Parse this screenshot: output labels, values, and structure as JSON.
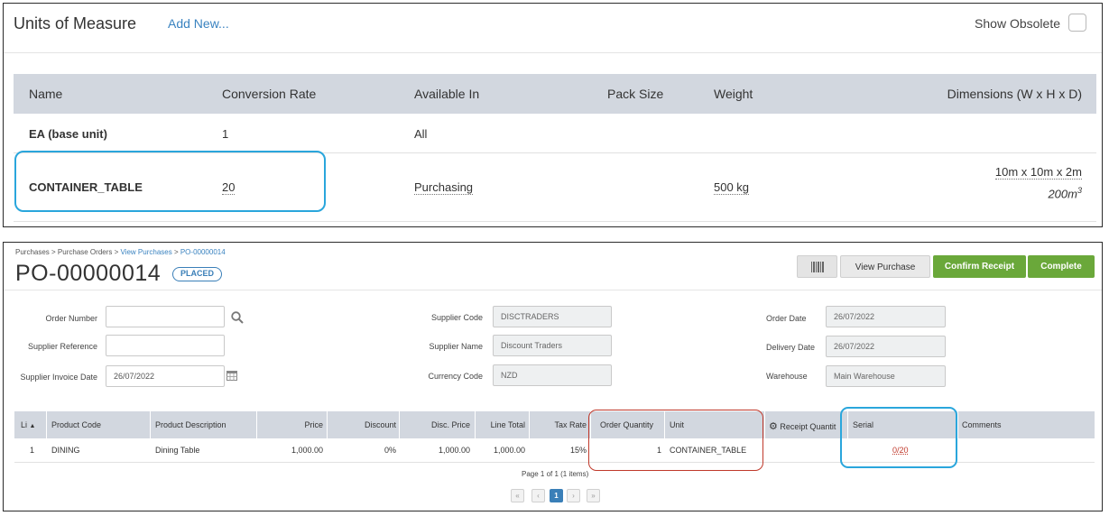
{
  "uom": {
    "title": "Units of Measure",
    "add_new": "Add New...",
    "show_obsolete": "Show Obsolete",
    "columns": [
      "Name",
      "Conversion Rate",
      "Available In",
      "Pack Size",
      "Weight",
      "Dimensions (W x H x D)"
    ],
    "rows": [
      {
        "name": "EA (base unit)",
        "conversion": "1",
        "available": "All",
        "pack": "",
        "weight": "",
        "dimensions": "",
        "volume": ""
      },
      {
        "name": "CONTAINER_TABLE",
        "conversion": "20",
        "available": "Purchasing",
        "pack": "",
        "weight": "500 kg",
        "dimensions": "10m x 10m x 2m",
        "volume": "200m",
        "volume_exp": "3"
      }
    ]
  },
  "po": {
    "breadcrumb": {
      "part1": "Purchases > Purchase Orders > ",
      "link1": "View Purchases",
      "sep": " > ",
      "link2": "PO-00000014"
    },
    "title": "PO-00000014",
    "status": "PLACED",
    "buttons": {
      "view_purchase": "View Purchase",
      "confirm_receipt": "Confirm Receipt",
      "complete": "Complete"
    },
    "fields": {
      "order_number": {
        "label": "Order Number",
        "value": ""
      },
      "supplier_reference": {
        "label": "Supplier Reference",
        "value": ""
      },
      "supplier_invoice_date": {
        "label": "Supplier Invoice Date",
        "value": "26/07/2022"
      },
      "supplier_code": {
        "label": "Supplier Code",
        "value": "DISCTRADERS"
      },
      "supplier_name": {
        "label": "Supplier Name",
        "value": "Discount Traders"
      },
      "currency_code": {
        "label": "Currency Code",
        "value": "NZD"
      },
      "order_date": {
        "label": "Order Date",
        "value": "26/07/2022"
      },
      "delivery_date": {
        "label": "Delivery Date",
        "value": "26/07/2022"
      },
      "warehouse": {
        "label": "Warehouse",
        "value": "Main Warehouse"
      }
    },
    "grid": {
      "columns": [
        "Li",
        "Product Code",
        "Product Description",
        "Price",
        "Discount",
        "Disc. Price",
        "Line Total",
        "Tax Rate",
        "Order Quantity",
        "Unit",
        "Receipt Quantit",
        "Serial",
        "Comments"
      ],
      "rows": [
        {
          "line": "1",
          "code": "DINING",
          "description": "Dining Table",
          "price": "1,000.00",
          "discount": "0%",
          "disc_price": "1,000.00",
          "line_total": "1,000.00",
          "tax_rate": "15%",
          "order_qty": "1",
          "unit": "CONTAINER_TABLE",
          "receipt_qty": "",
          "serial": "0/20",
          "comments": ""
        }
      ]
    },
    "pager": {
      "text": "Page 1 of 1 (1 items)",
      "current": "1"
    }
  },
  "colors": {
    "accent_blue": "#2aa6dc",
    "link_blue": "#3a83c0",
    "green": "#6aa83a",
    "red": "#c0392b"
  }
}
